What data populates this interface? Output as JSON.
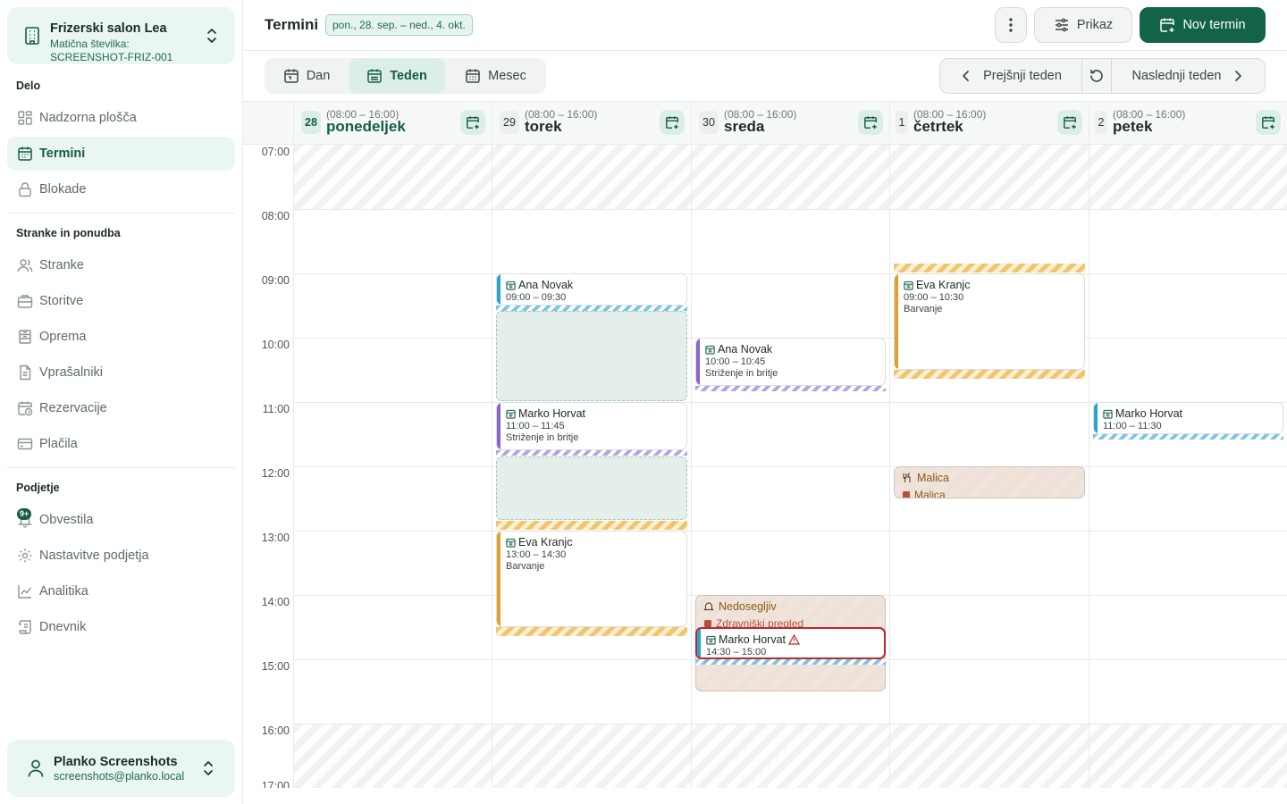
{
  "org": {
    "name": "Frizerski salon Lea",
    "sub_label": "Matična številka:",
    "sub_value": "SCREENSHOT-FRIZ-001"
  },
  "sections": {
    "work": "Delo",
    "clients": "Stranke in ponudba",
    "company": "Podjetje"
  },
  "nav": {
    "dashboard": "Nadzorna plošča",
    "appointments": "Termini",
    "blocks": "Blokade",
    "clients": "Stranke",
    "services": "Storitve",
    "equipment": "Oprema",
    "questionnaires": "Vprašalniki",
    "reservations": "Rezervacije",
    "payments": "Plačila",
    "notifications": "Obvestila",
    "settings": "Nastavitve podjetja",
    "analytics": "Analitika",
    "log": "Dnevnik"
  },
  "badge": {
    "notifications": "9+"
  },
  "user": {
    "name": "Planko Screenshots",
    "email": "screenshots@planko.local"
  },
  "header": {
    "title": "Termini",
    "date_range": "pon., 28. sep. – ned., 4. okt.",
    "view_label": "Prikaz",
    "new_label": "Nov termin"
  },
  "views": {
    "day": "Dan",
    "week": "Teden",
    "month": "Mesec"
  },
  "week_nav": {
    "prev": "Prejšnji teden",
    "next": "Naslednji teden"
  },
  "days": [
    {
      "num": "28",
      "hours": "(08:00 – 16:00)",
      "name": "ponedeljek"
    },
    {
      "num": "29",
      "hours": "(08:00 – 16:00)",
      "name": "torek"
    },
    {
      "num": "30",
      "hours": "(08:00 – 16:00)",
      "name": "sreda"
    },
    {
      "num": "1",
      "hours": "(08:00 – 16:00)",
      "name": "četrtek"
    },
    {
      "num": "2",
      "hours": "(08:00 – 16:00)",
      "name": "petek"
    }
  ],
  "times": [
    "07:00",
    "08:00",
    "09:00",
    "10:00",
    "11:00",
    "12:00",
    "13:00",
    "14:00",
    "15:00",
    "16:00",
    "17:00"
  ],
  "appointments": {
    "a1": {
      "client": "Ana Novak",
      "time": "09:00 – 09:30"
    },
    "a2": {
      "client": "Marko Horvat",
      "time": "11:00 – 11:45",
      "service": "Striženje in britje"
    },
    "a3": {
      "client": "Eva Kranjc",
      "time": "13:00 – 14:30",
      "service": "Barvanje"
    },
    "a4": {
      "client": "Ana Novak",
      "time": "10:00 – 10:45",
      "service": "Striženje in britje"
    },
    "a5": {
      "client": "Marko Horvat",
      "time": "14:30 – 15:00"
    },
    "a6": {
      "client": "Eva Kranjc",
      "time": "09:00 – 10:30",
      "service": "Barvanje"
    },
    "a7": {
      "client": "Marko Horvat",
      "time": "11:00 – 11:30"
    }
  },
  "blocks": {
    "b1": {
      "title": "Nedosegljiv",
      "sub": "Zdravniški pregled"
    },
    "b2": {
      "title": "Malica",
      "sub": "Malica"
    }
  },
  "colors": {
    "accent": "#13634a",
    "blue": "#2aa3cf",
    "purple": "#8a63d2",
    "orange": "#e0a02a",
    "conflict": "#c0262d"
  }
}
